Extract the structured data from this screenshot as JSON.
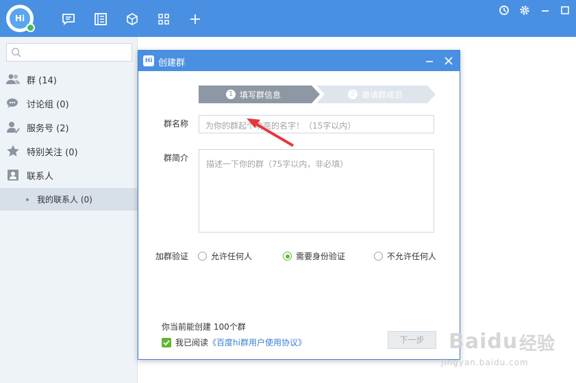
{
  "app": {
    "avatar_text": "Hi"
  },
  "sidebar": {
    "search_placeholder": "",
    "items": [
      {
        "label": "群 (14)"
      },
      {
        "label": "讨论组 (0)"
      },
      {
        "label": "服务号 (2)"
      },
      {
        "label": "特别关注 (0)"
      },
      {
        "label": "联系人"
      }
    ],
    "sub_item": {
      "label": "我的联系人 (0)"
    }
  },
  "dialog": {
    "title": "创建群",
    "logo_text": "Hi",
    "steps": [
      {
        "num": "1",
        "label": "填写群信息",
        "active": true
      },
      {
        "num": "2",
        "label": "邀请群成员",
        "active": false
      }
    ],
    "name_label": "群名称",
    "name_placeholder": "为你的群起个响亮的名字！（15字以内）",
    "intro_label": "群简介",
    "intro_placeholder": "描述一下你的群（75字以内，非必填）",
    "verify_label": "加群验证",
    "verify_options": [
      {
        "label": "允许任何人",
        "checked": false
      },
      {
        "label": "需要身份验证",
        "checked": true
      },
      {
        "label": "不允许任何人",
        "checked": false
      }
    ],
    "quota_text": "你当前能创建 100个群",
    "agree_prefix": "我已阅读",
    "agree_link": "《百度hi群用户使用协议》",
    "agree_checked": true,
    "next_label": "下一步"
  },
  "watermark": {
    "brand": "Baidu",
    "cn": "经验",
    "url": "jingyan.baidu.com"
  },
  "colors": {
    "accent": "#4a90e2",
    "green": "#5fb533",
    "step_active": "#8e98a4",
    "step_inactive": "#dfe5ec",
    "arrow": "#e8363b"
  }
}
